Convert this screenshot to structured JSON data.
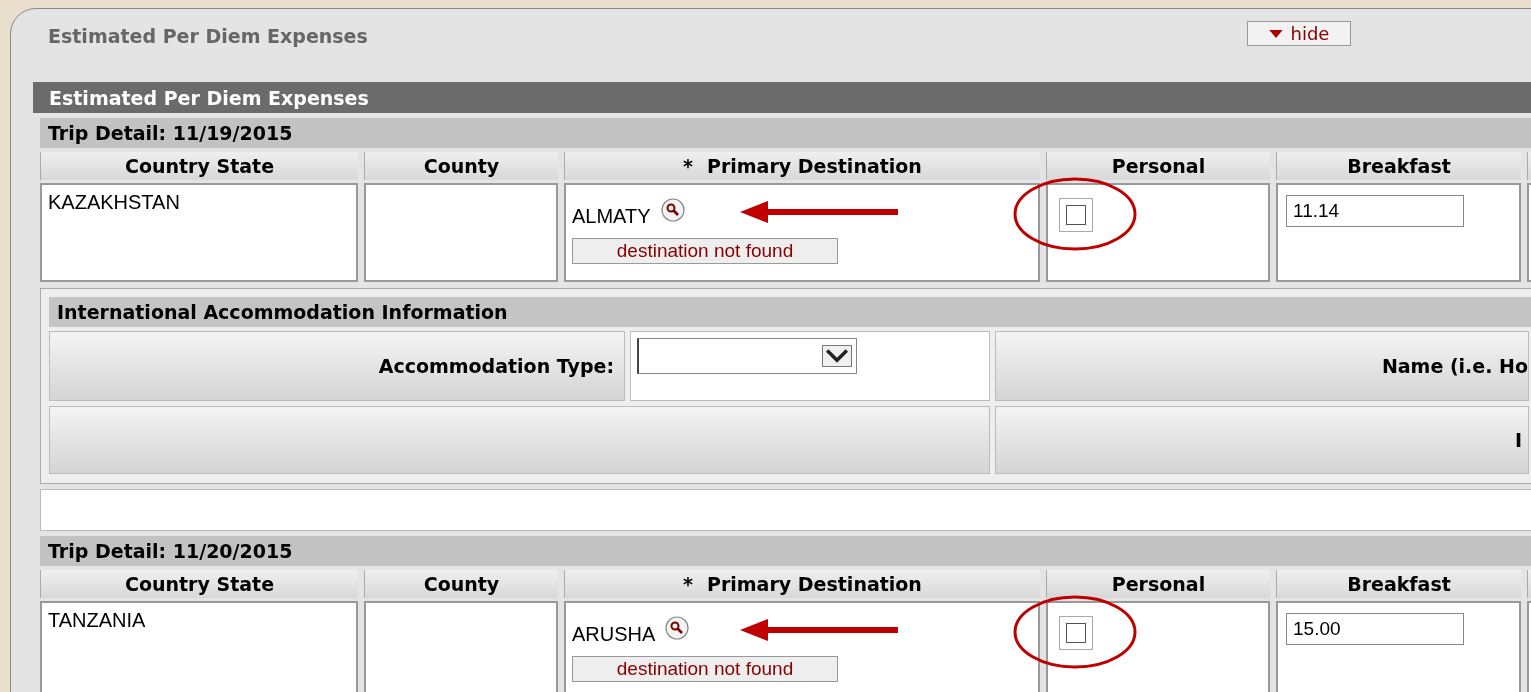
{
  "panel": {
    "title": "Estimated Per Diem Expenses",
    "hide_button": "hide"
  },
  "section": {
    "title": "Estimated Per Diem Expenses"
  },
  "trips": [
    {
      "title": "Trip Detail: 11/19/2015",
      "columns": [
        {
          "label": "Country State"
        },
        {
          "label": "County"
        },
        {
          "label": "Primary Destination",
          "mark": "*"
        },
        {
          "label": "Personal"
        },
        {
          "label": "Breakfast"
        }
      ],
      "country": "KAZAKHSTAN",
      "destination": "ALMATY",
      "destination_error": "destination not found",
      "personal": {
        "checked": false
      },
      "breakfast": "11.14",
      "annotated": true,
      "accommodation": {
        "title": "International Accommodation Information",
        "type_label": "Accommodation Type:",
        "name_label": "Name (i.e. Ho",
        "row_2_label": "I"
      }
    },
    {
      "title": "Trip Detail: 11/20/2015",
      "columns": [
        {
          "label": "Country State"
        },
        {
          "label": "County"
        },
        {
          "label": "Primary Destination",
          "mark": "*"
        },
        {
          "label": "Personal"
        },
        {
          "label": "Breakfast"
        }
      ],
      "country": "TANZANIA",
      "destination": "ARUSHA",
      "destination_error": "destination not found",
      "personal": {
        "checked": false
      },
      "breakfast": "15.00",
      "annotated": true
    }
  ]
}
